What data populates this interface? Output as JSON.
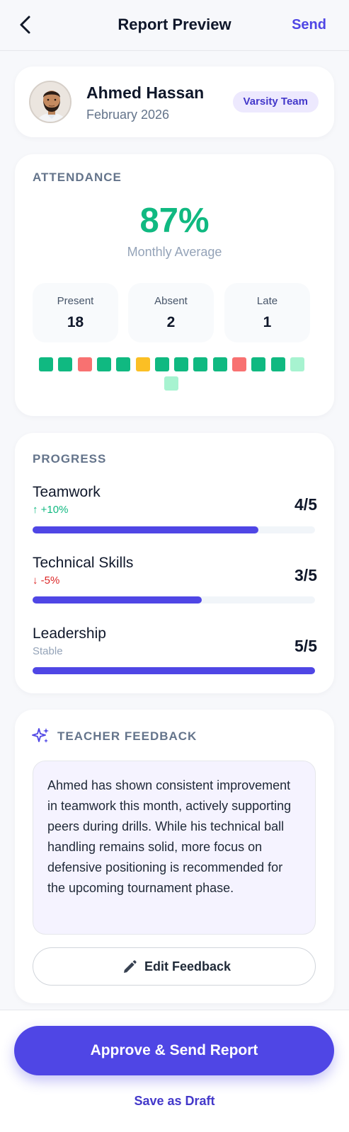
{
  "header": {
    "title": "Report Preview",
    "action_label": "Send",
    "back_icon": "chevron-left-icon"
  },
  "student": {
    "name": "Ahmed Hassan",
    "period": "February 2026",
    "team": "Varsity Team"
  },
  "attendance": {
    "section_title": "ATTENDANCE",
    "percentage": "87%",
    "percentage_label": "Monthly Average",
    "stats": [
      {
        "label": "Present",
        "value": "18"
      },
      {
        "label": "Absent",
        "value": "2"
      },
      {
        "label": "Late",
        "value": "1"
      }
    ],
    "days": [
      "present",
      "present",
      "absent",
      "present",
      "present",
      "late",
      "present",
      "present",
      "present",
      "present",
      "absent",
      "present",
      "present",
      "upcoming",
      "upcoming"
    ],
    "status_colors": {
      "present": "#10b981",
      "absent": "#f87171",
      "late": "#fbbf24",
      "upcoming": "#a7f3d0"
    }
  },
  "progress": {
    "section_title": "PROGRESS",
    "skills": [
      {
        "name": "Teamwork",
        "trend": "+10%",
        "trend_direction": "up",
        "score": "4/5",
        "fraction": 0.8
      },
      {
        "name": "Technical Skills",
        "trend": "-5%",
        "trend_direction": "down",
        "score": "3/5",
        "fraction": 0.6
      },
      {
        "name": "Leadership",
        "trend": "Stable",
        "trend_direction": "flat",
        "score": "5/5",
        "fraction": 1.0
      }
    ]
  },
  "feedback": {
    "section_title": "TEACHER FEEDBACK",
    "icon": "sparkle-icon",
    "text": "Ahmed has shown consistent improvement in teamwork this month, actively supporting peers during drills. While his technical ball handling remains solid, more focus on defensive positioning is recommended for the upcoming tournament phase.",
    "edit_label": "Edit Feedback"
  },
  "footer": {
    "approve_label": "Approve & Send Report",
    "draft_label": "Save as Draft"
  },
  "colors": {
    "accent": "#4f46e5",
    "success": "#10b981",
    "danger": "#dc2626"
  }
}
